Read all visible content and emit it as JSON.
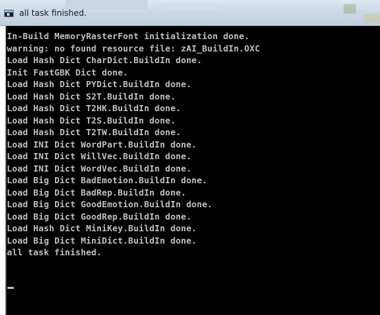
{
  "window": {
    "title": "all task finished.",
    "icon": "console-window-icon"
  },
  "console": {
    "lines": [
      "In-Build MemoryRasterFont initialization done.",
      "warning: no found resource file: zAI_BuildIn.OXC",
      "Load Hash Dict CharDict.BuildIn done.",
      "Init FastGBK Dict done.",
      "Load Hash Dict PYDict.BuildIn done.",
      "Load Hash Dict S2T.BuildIn done.",
      "Load Hash Dict T2HK.BuildIn done.",
      "Load Hash Dict T2S.BuildIn done.",
      "Load Hash Dict T2TW.BuildIn done.",
      "Load INI Dict WordPart.BuildIn done.",
      "Load INI Dict WillVec.BuildIn done.",
      "Load INI Dict WordVec.BuildIn done.",
      "Load Big Dict BadEmotion.BuildIn done.",
      "Load Big Dict BadRep.BuildIn done.",
      "Load Big Dict GoodEmotion.BuildIn done.",
      "Load Big Dict GoodRep.BuildIn done.",
      "Load Hash Dict MiniKey.BuildIn done.",
      "Load Big Dict MiniDict.BuildIn done.",
      "all task finished."
    ]
  },
  "colors": {
    "console_background": "#000000",
    "console_text": "#c0c0c0"
  }
}
